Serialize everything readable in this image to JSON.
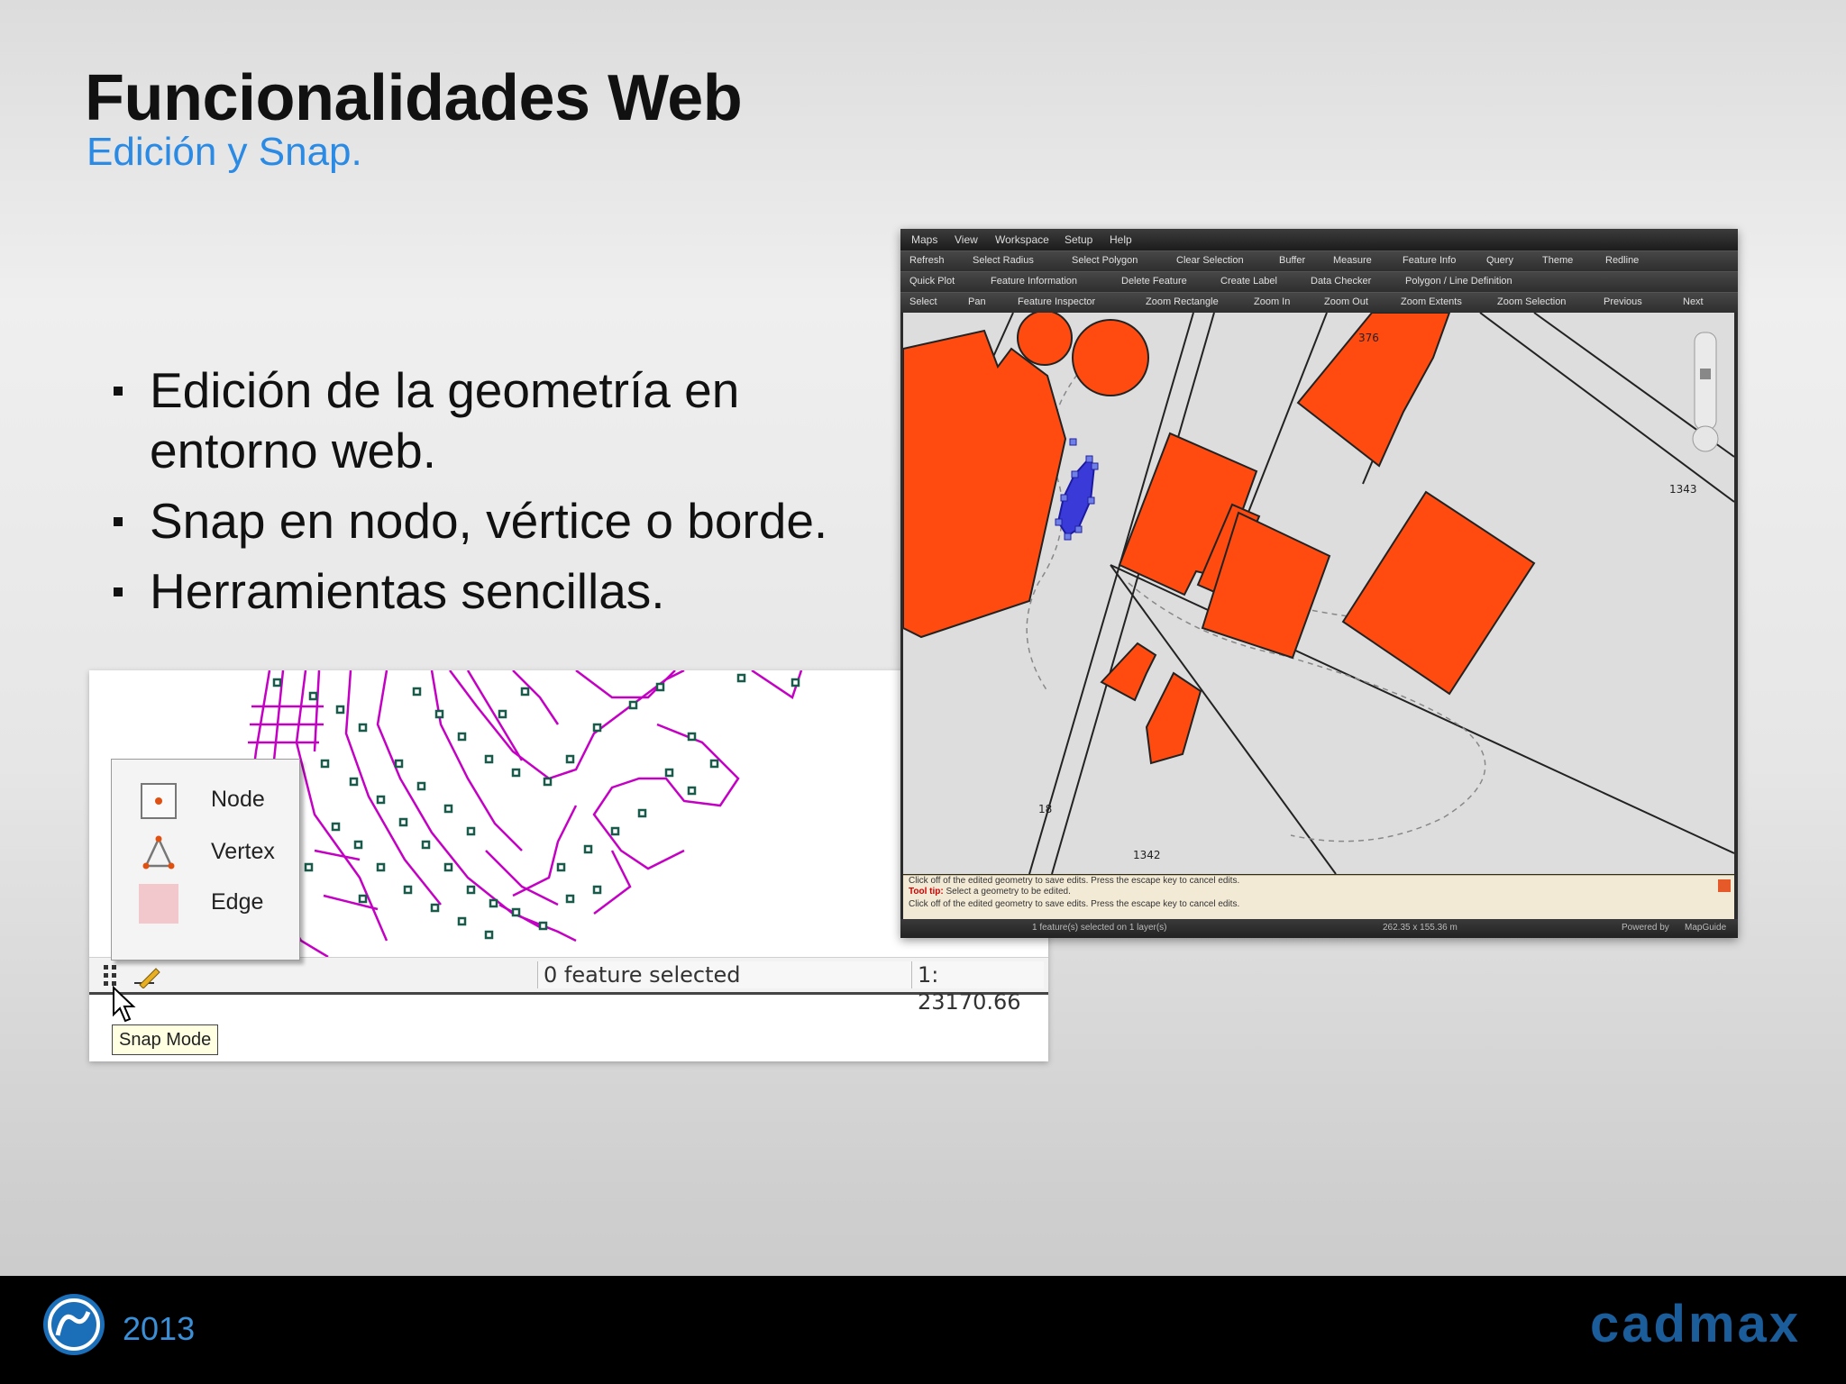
{
  "slide": {
    "title": "Funcionalidades Web",
    "subtitle": "Edición y Snap.",
    "bullets": [
      "Edición de la geometría en entorno web.",
      "Snap en nodo, vértice o borde.",
      "Herramientas sencillas."
    ]
  },
  "snap_panel": {
    "options": [
      "Node",
      "Vertex",
      "Edge"
    ],
    "status_selected": "0 feature selected",
    "status_scale": "1: 23170.66",
    "tooltip": "Snap Mode",
    "icons": [
      "snap-mode-icon",
      "edit-tool-icon",
      "cursor-icon"
    ]
  },
  "app": {
    "menu": [
      "Maps",
      "View",
      "Workspace",
      "Setup",
      "Help"
    ],
    "toolbar1": [
      "Refresh",
      "Select Radius",
      "Select Polygon",
      "Clear Selection",
      "Buffer",
      "Measure",
      "Feature Info",
      "Query",
      "Theme",
      "Redline"
    ],
    "toolbar2": [
      "Quick Plot",
      "Feature Information",
      "Delete Feature",
      "Create Label",
      "Data Checker",
      "Polygon / Line Definition"
    ],
    "toolbar3": [
      "Select",
      "Pan",
      "Feature Inspector",
      "Zoom Rectangle",
      "Zoom In",
      "Zoom Out",
      "Zoom Extents",
      "Zoom Selection",
      "Previous",
      "Next"
    ],
    "map_labels": [
      "376",
      "1343",
      "1342",
      "18"
    ],
    "message": {
      "line1": "Click off of the edited geometry to save edits. Press the escape key to cancel edits.",
      "tooltip_label": "Tool tip:",
      "tooltip_text": "Select a geometry to be edited.",
      "line3": "Click off of the edited geometry to save edits. Press the escape key to cancel edits."
    },
    "footer_status": "1 feature(s) selected on 1 layer(s)",
    "footer_scale": "262.35 x 155.36 m",
    "powered_by": "Powered by",
    "mapguide": "MapGuide"
  },
  "footer": {
    "year": "2013",
    "brand": "cadmax"
  },
  "colors": {
    "accent_blue": "#2a8ae4",
    "building_fill": "#ff4a10",
    "parcel_magenta": "#c400c4",
    "edit_blue": "#3a3ad8",
    "brand_blue": "#1b5d9a"
  }
}
